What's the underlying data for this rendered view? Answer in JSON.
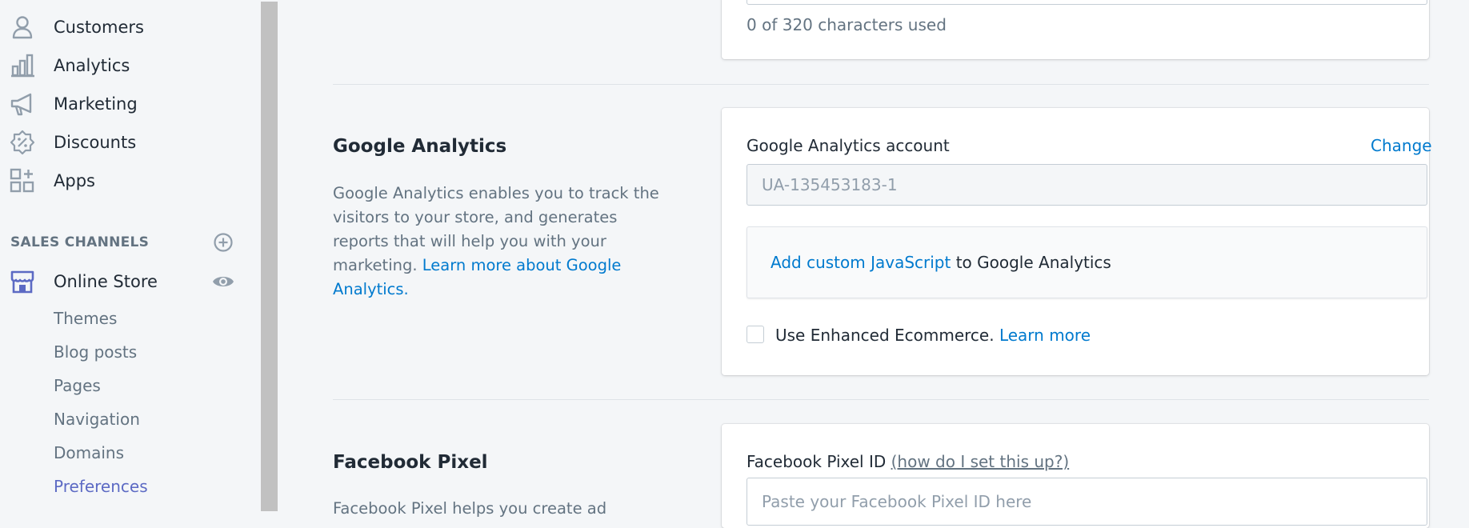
{
  "sidebar": {
    "items": [
      {
        "label": "Customers",
        "icon": "person-icon"
      },
      {
        "label": "Analytics",
        "icon": "bar-chart-icon"
      },
      {
        "label": "Marketing",
        "icon": "megaphone-icon"
      },
      {
        "label": "Discounts",
        "icon": "discount-badge-icon"
      },
      {
        "label": "Apps",
        "icon": "apps-grid-icon"
      }
    ],
    "sales_channels_title": "SALES CHANNELS",
    "online_store": {
      "label": "Online Store",
      "icon": "store-icon"
    },
    "sub_items": [
      "Themes",
      "Blog posts",
      "Pages",
      "Navigation",
      "Domains",
      "Preferences"
    ],
    "active_sub_item": "Preferences"
  },
  "meta_description": {
    "char_count_text": "0 of 320 characters used"
  },
  "google_analytics": {
    "heading": "Google Analytics",
    "description": "Google Analytics enables you to track the visitors to your store, and generates reports that will help you with your marketing.",
    "learn_more_link": "Learn more about Google Analytics.",
    "account_label": "Google Analytics account",
    "change_link": "Change",
    "account_value": "UA-135453183-1",
    "custom_js_link": "Add custom JavaScript",
    "custom_js_suffix": "to Google Analytics",
    "enhanced_label": "Use Enhanced Ecommerce.",
    "enhanced_learn_more": "Learn more",
    "enhanced_checked": false
  },
  "facebook_pixel": {
    "heading": "Facebook Pixel",
    "description": "Facebook Pixel helps you create ad",
    "id_label": "Facebook Pixel ID",
    "help_link": "(how do I set this up?)",
    "id_placeholder": "Paste your Facebook Pixel ID here"
  },
  "colors": {
    "link": "#007ace",
    "active_nav": "#5c6ac4",
    "store_icon": "#5c6ac4"
  }
}
